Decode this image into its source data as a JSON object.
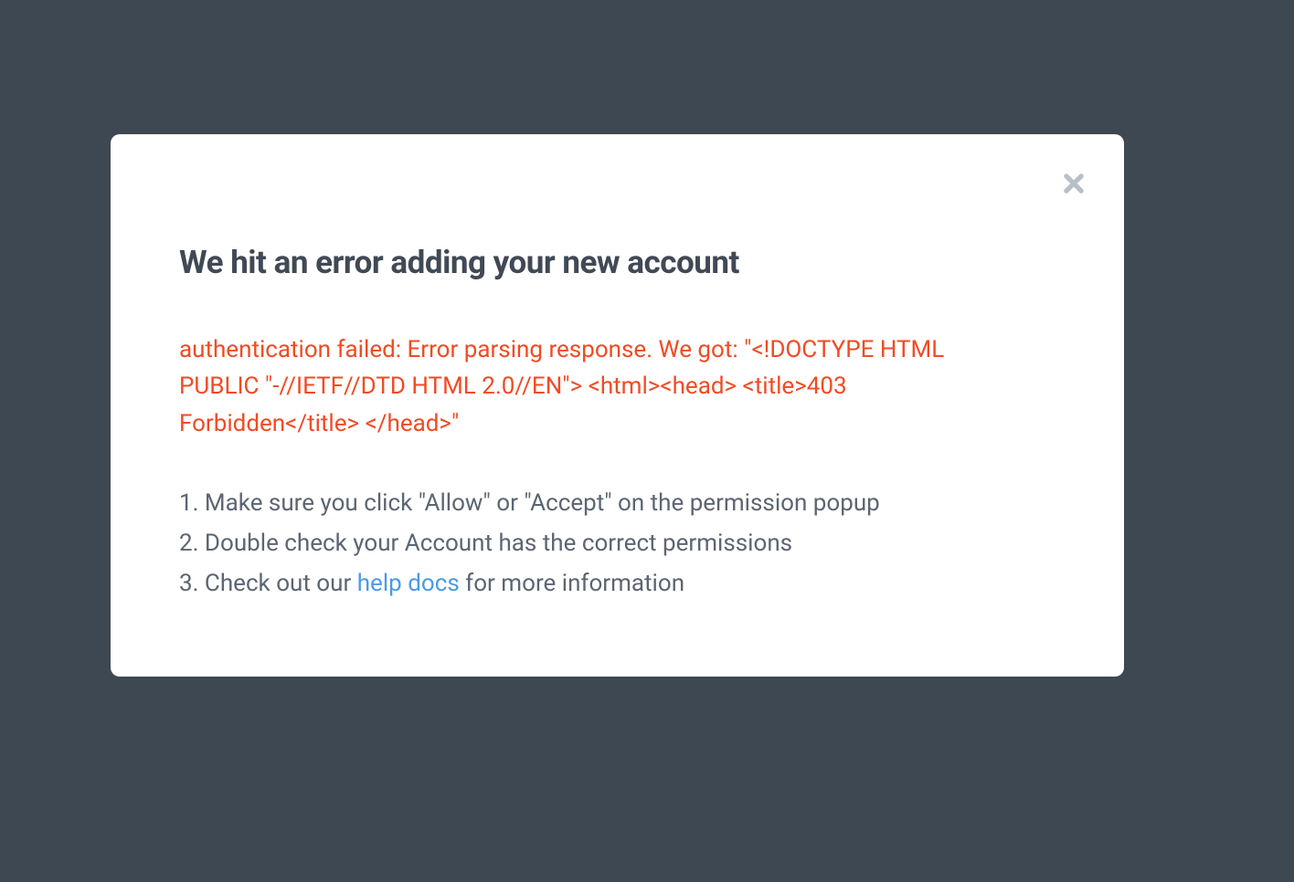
{
  "modal": {
    "title": "We hit an error adding your new account",
    "error_message": "authentication failed: Error parsing response. We got: \"<!DOCTYPE HTML PUBLIC \"-//IETF//DTD HTML 2.0//EN\"> <html><head> <title>403 Forbidden</title> </head>\"",
    "instructions": [
      {
        "prefix": "1. ",
        "text": "Make sure you click \"Allow\" or \"Accept\" on the permission popup"
      },
      {
        "prefix": "2. ",
        "text": "Double check your Account has the correct permissions"
      },
      {
        "prefix": "3. ",
        "text_before": "Check out our ",
        "link_text": "help docs",
        "text_after": " for more information"
      }
    ]
  }
}
